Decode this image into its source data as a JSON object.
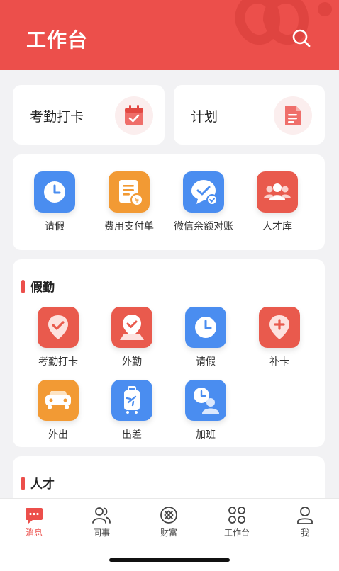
{
  "header": {
    "title": "工作台",
    "search_icon": "search-icon"
  },
  "quick_actions": [
    {
      "label": "考勤打卡",
      "icon": "calendar-check-icon"
    },
    {
      "label": "计划",
      "icon": "document-icon"
    }
  ],
  "apps": [
    {
      "label": "请假",
      "icon": "clock-icon",
      "color": "#4a8df0"
    },
    {
      "label": "费用支付单",
      "icon": "payment-note-icon",
      "color": "#f29a34"
    },
    {
      "label": "微信余额对账",
      "icon": "wechat-check-icon",
      "color": "#4a8df0"
    },
    {
      "label": "人才库",
      "icon": "people-icon",
      "color": "#e95a4d"
    }
  ],
  "attendance": {
    "title": "假勤",
    "items": [
      {
        "label": "考勤打卡",
        "icon": "location-check-icon",
        "color": "#e95a4d"
      },
      {
        "label": "外勤",
        "icon": "field-check-icon",
        "color": "#e95a4d"
      },
      {
        "label": "请假",
        "icon": "clock-icon",
        "color": "#4a8df0"
      },
      {
        "label": "补卡",
        "icon": "location-plus-icon",
        "color": "#e95a4d"
      },
      {
        "label": "外出",
        "icon": "car-icon",
        "color": "#f29a34"
      },
      {
        "label": "出差",
        "icon": "luggage-plane-icon",
        "color": "#4a8df0"
      },
      {
        "label": "加班",
        "icon": "overtime-clock-icon",
        "color": "#4a8df0"
      }
    ]
  },
  "talent": {
    "title": "人才"
  },
  "tabbar": {
    "tabs": [
      {
        "label": "消息",
        "icon": "chat-bubble-icon",
        "active": true
      },
      {
        "label": "同事",
        "icon": "colleagues-icon",
        "active": false
      },
      {
        "label": "财富",
        "icon": "wealth-icon",
        "active": false
      },
      {
        "label": "工作台",
        "icon": "workbench-icon",
        "active": false
      },
      {
        "label": "我",
        "icon": "person-icon",
        "active": false
      }
    ]
  },
  "colors": {
    "brand": "#ec4f4b",
    "blue": "#4a8df0",
    "orange": "#f29a34"
  }
}
